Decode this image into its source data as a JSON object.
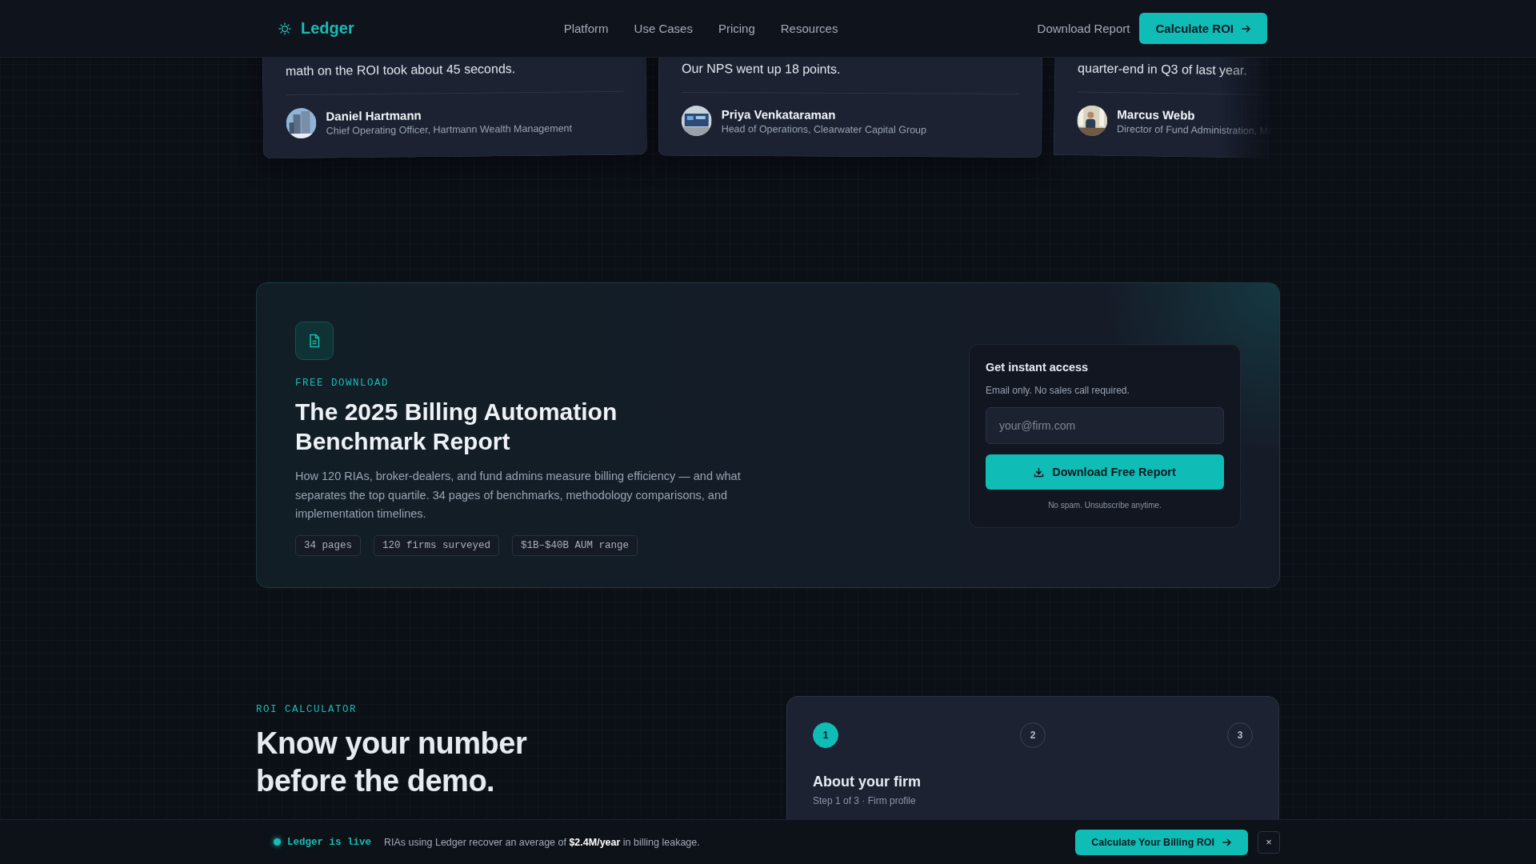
{
  "nav": {
    "logo": "Ledger",
    "links": [
      "Platform",
      "Use Cases",
      "Pricing",
      "Resources"
    ],
    "secondary": "Download Report",
    "cta": "Calculate ROI"
  },
  "testimonials": [
    {
      "quote": "math on the ROI took about 45 seconds.",
      "name": "Daniel Hartmann",
      "role": "Chief Operating Officer, Hartmann Wealth Management"
    },
    {
      "quote": "Our NPS went up 18 points.",
      "name": "Priya Venkataraman",
      "role": "Head of Operations, Clearwater Capital Group"
    },
    {
      "quote": "quarter-end in Q3 of last year.",
      "name": "Marcus Webb",
      "role": "Director of Fund Administration, Me"
    }
  ],
  "report": {
    "eyebrow": "FREE DOWNLOAD",
    "title": "The 2025 Billing Automation Benchmark Report",
    "description": "How 120 RIAs, broker-dealers, and fund admins measure billing efficiency — and what separates the top quartile. 34 pages of benchmarks, methodology comparisons, and implementation timelines.",
    "tags": [
      "34 pages",
      "120 firms surveyed",
      "$1B–$40B AUM range"
    ],
    "form": {
      "title": "Get instant access",
      "subtitle": "Email only. No sales call required.",
      "placeholder": "your@firm.com",
      "button": "Download Free Report",
      "note": "No spam. Unsubscribe anytime."
    }
  },
  "roi": {
    "eyebrow": "ROI CALCULATOR",
    "title": "Know your number before the demo.",
    "steps": [
      {
        "label": "1",
        "selected": true
      },
      {
        "label": "2",
        "selected": false
      },
      {
        "label": "3",
        "selected": false
      }
    ],
    "step_title": "About your firm",
    "step_caption": "Step 1 of 3 · Firm profile"
  },
  "banner": {
    "status": "Ledger is live",
    "message": "RIAs using Ledger recover an average of **$2.4M/year** in billing leakage.",
    "cta": "Calculate Your Billing ROI",
    "close": "×"
  }
}
